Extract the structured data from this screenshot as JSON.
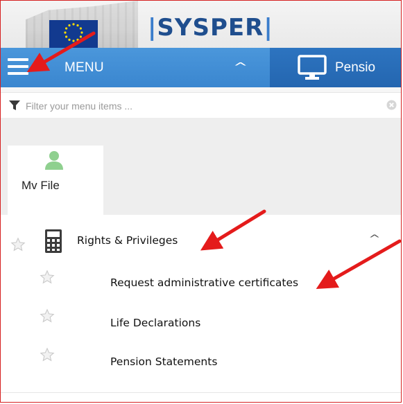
{
  "header": {
    "brand_prefix": "|",
    "brand_name": "SYSPER",
    "brand_suffix": "|"
  },
  "menubar": {
    "hamburger_icon": "hamburger-icon",
    "menu_label": "MENU",
    "caret_icon": "chevron-up-icon",
    "pension_label": "Pensio",
    "pension_icon": "monitor-icon"
  },
  "filter": {
    "placeholder": "Filter your menu items ...",
    "value": ""
  },
  "tabs": [
    {
      "label": "Mv File",
      "icon": "person-icon"
    }
  ],
  "menu": {
    "group": {
      "label": "Rights & Privileges",
      "icon": "calculator-icon"
    },
    "items": [
      {
        "label": "Request administrative certificates"
      },
      {
        "label": "Life Declarations"
      },
      {
        "label": "Pension Statements"
      }
    ]
  },
  "colors": {
    "menubar": "#3f8cd4",
    "pension_tab": "#2a6db8",
    "brand": "#1f4e8e",
    "person_icon": "#8fd08f",
    "annotation_arrow": "#e41b1b"
  }
}
